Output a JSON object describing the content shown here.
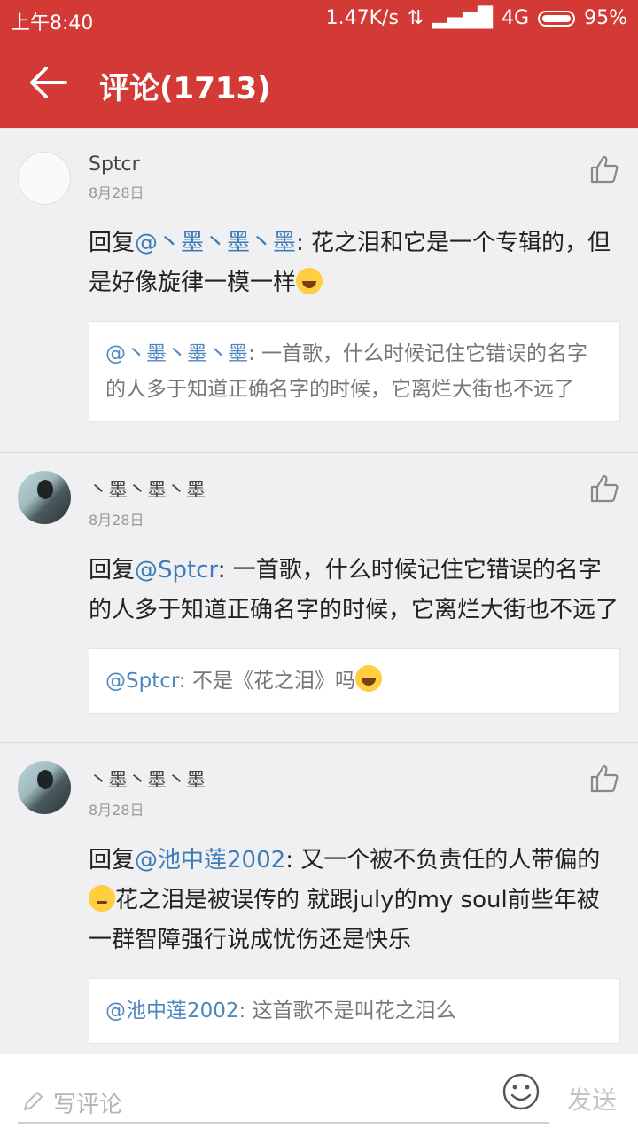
{
  "status": {
    "time": "上午8:40",
    "speed": "1.47K/s",
    "network": "4G",
    "battery": "95%"
  },
  "header": {
    "title": "评论(1713)"
  },
  "comments": [
    {
      "user": "Sptcr",
      "date": "8月28日",
      "reply_prefix": "回复",
      "reply_to": "@丶墨丶墨丶墨",
      "text": ": 花之泪和它是一个专辑的，但是好像旋律一模一样",
      "emoji": "laugh-cry-emoji",
      "quote": {
        "user": "@丶墨丶墨丶墨",
        "text": ": 一首歌，什么时候记住它错误的名字的人多于知道正确名字的时候，它离烂大街也不远了"
      }
    },
    {
      "user": "丶墨丶墨丶墨",
      "date": "8月28日",
      "reply_prefix": "回复",
      "reply_to": "@Sptcr",
      "text": ": 一首歌，什么时候记住它错误的名字的人多于知道正确名字的时候，它离烂大街也不远了",
      "quote": {
        "user": "@Sptcr",
        "text": ": 不是《花之泪》吗"
      }
    },
    {
      "user": "丶墨丶墨丶墨",
      "date": "8月28日",
      "reply_prefix": "回复",
      "reply_to": "@池中莲2002",
      "text_a": ": 又一个被不负责任的人带偏的",
      "text_b": "花之泪是被误传的 就跟july的my soul前些年被一群智障强行说成忧伤还是快乐",
      "quote": {
        "user": "@池中莲2002",
        "text": ": 这首歌不是叫花之泪么"
      }
    }
  ],
  "footer": {
    "placeholder": "写评论",
    "send_label": "发送"
  },
  "colors": {
    "accent": "#d33a35",
    "mention": "#3d7cb8"
  }
}
